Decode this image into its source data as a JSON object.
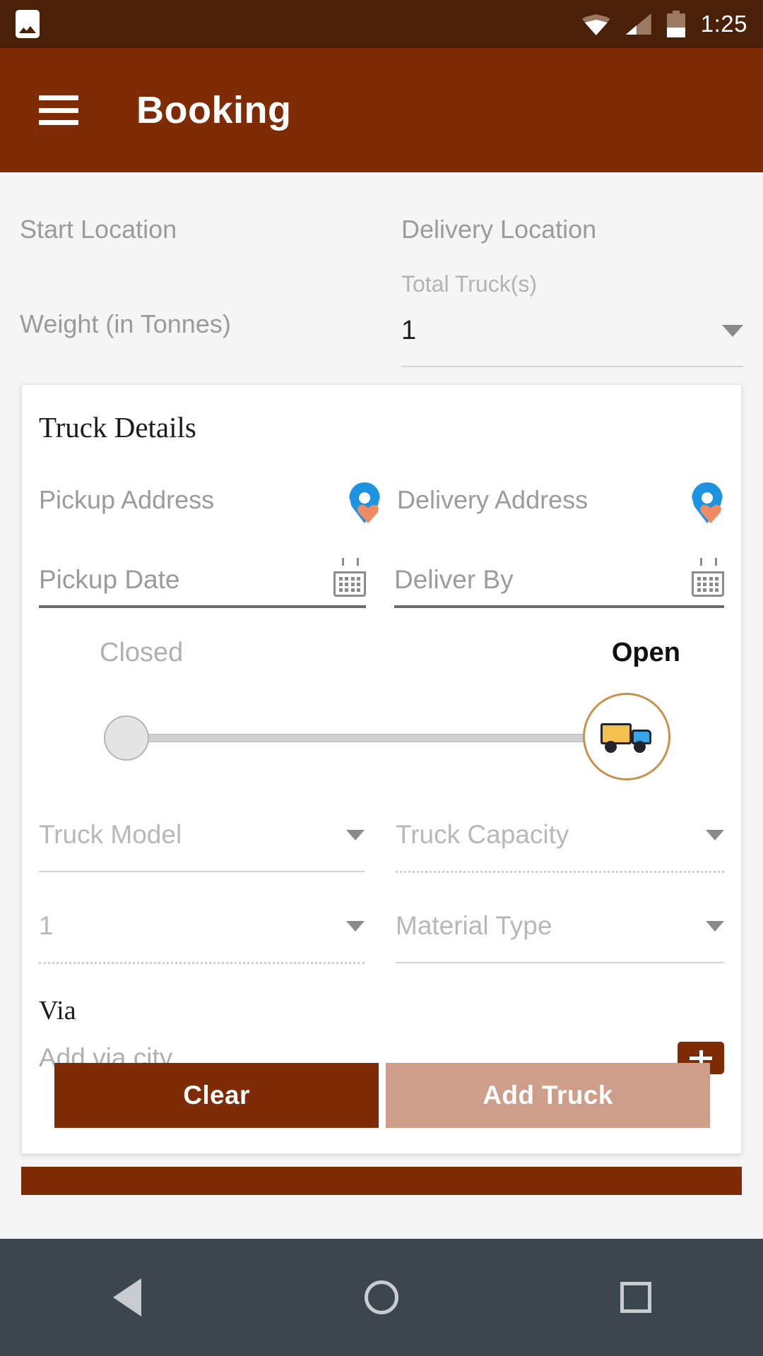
{
  "statusbar": {
    "time": "1:25",
    "icons": [
      "gallery-icon",
      "wifi-icon",
      "signal-icon",
      "battery-icon"
    ]
  },
  "appbar": {
    "menu_icon": "hamburger-menu-icon",
    "title": "Booking"
  },
  "form": {
    "start_location_placeholder": "Start Location",
    "weight_placeholder": "Weight (in Tonnes)",
    "delivery_location_placeholder": "Delivery Location",
    "total_trucks_label": "Total Truck(s)",
    "total_trucks_value": "1"
  },
  "card": {
    "title": "Truck Details",
    "pickup_address_placeholder": "Pickup Address",
    "delivery_address_placeholder": "Delivery Address",
    "pickup_date_placeholder": "Pickup Date",
    "deliver_by_placeholder": "Deliver By",
    "slider": {
      "left_label": "Closed",
      "right_label": "Open",
      "thumb_icon": "truck-icon"
    },
    "truck_model_placeholder": "Truck Model",
    "truck_capacity_placeholder": "Truck Capacity",
    "quantity_value": "1",
    "material_type_placeholder": "Material Type",
    "via_title": "Via",
    "via_placeholder": "Add via city",
    "add_via_icon": "add-ticket-icon",
    "clear_label": "Clear",
    "add_truck_label": "Add Truck"
  },
  "colors": {
    "brand": "#7e2b06",
    "statusbar": "#4a2008",
    "add_truck": "#cf9e8b",
    "pin_blue": "#1e93e0",
    "pin_heart": "#f08a62",
    "slider_ring": "#c7924c"
  },
  "navbar": {
    "back": "back-nav-icon",
    "home": "home-nav-icon",
    "recents": "recents-nav-icon"
  }
}
